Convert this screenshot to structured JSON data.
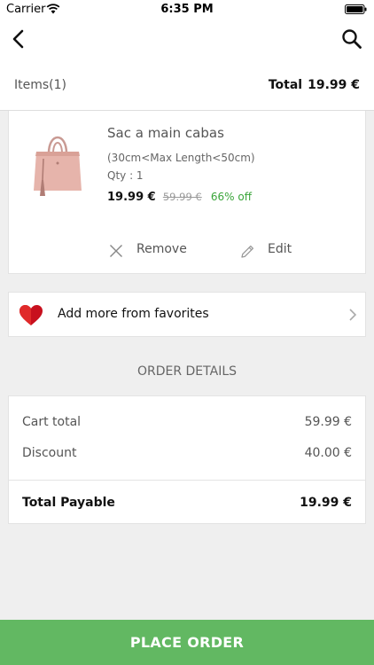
{
  "status_bar": {
    "carrier": "Carrier",
    "time": "6:35 PM"
  },
  "nav": {
    "back_icon": "chevron-left-icon",
    "search_icon": "search-icon"
  },
  "summary": {
    "items_label": "Items(1)",
    "total_label": "Total",
    "total_value": "19.99 €"
  },
  "cart_item": {
    "name": "Sac a main cabas",
    "variant": "(30cm<Max Length<50cm)",
    "qty": "Qty : 1",
    "price": "19.99 €",
    "old_price": "59.99 €",
    "discount": "66% off",
    "remove_label": "Remove",
    "edit_label": "Edit"
  },
  "favorites": {
    "label": "Add more from favorites",
    "icon": "heart-icon"
  },
  "order_details": {
    "title": "ORDER DETAILS",
    "cart_total_label": "Cart total",
    "cart_total_value": "59.99 €",
    "discount_label": "Discount",
    "discount_value": "40.00 €",
    "payable_label": "Total Payable",
    "payable_value": "19.99 €"
  },
  "action": {
    "place_order_label": "PLACE ORDER"
  },
  "colors": {
    "accent_green": "#62b862",
    "discount_green": "#3aa53a",
    "heart_red": "#c8101e"
  }
}
